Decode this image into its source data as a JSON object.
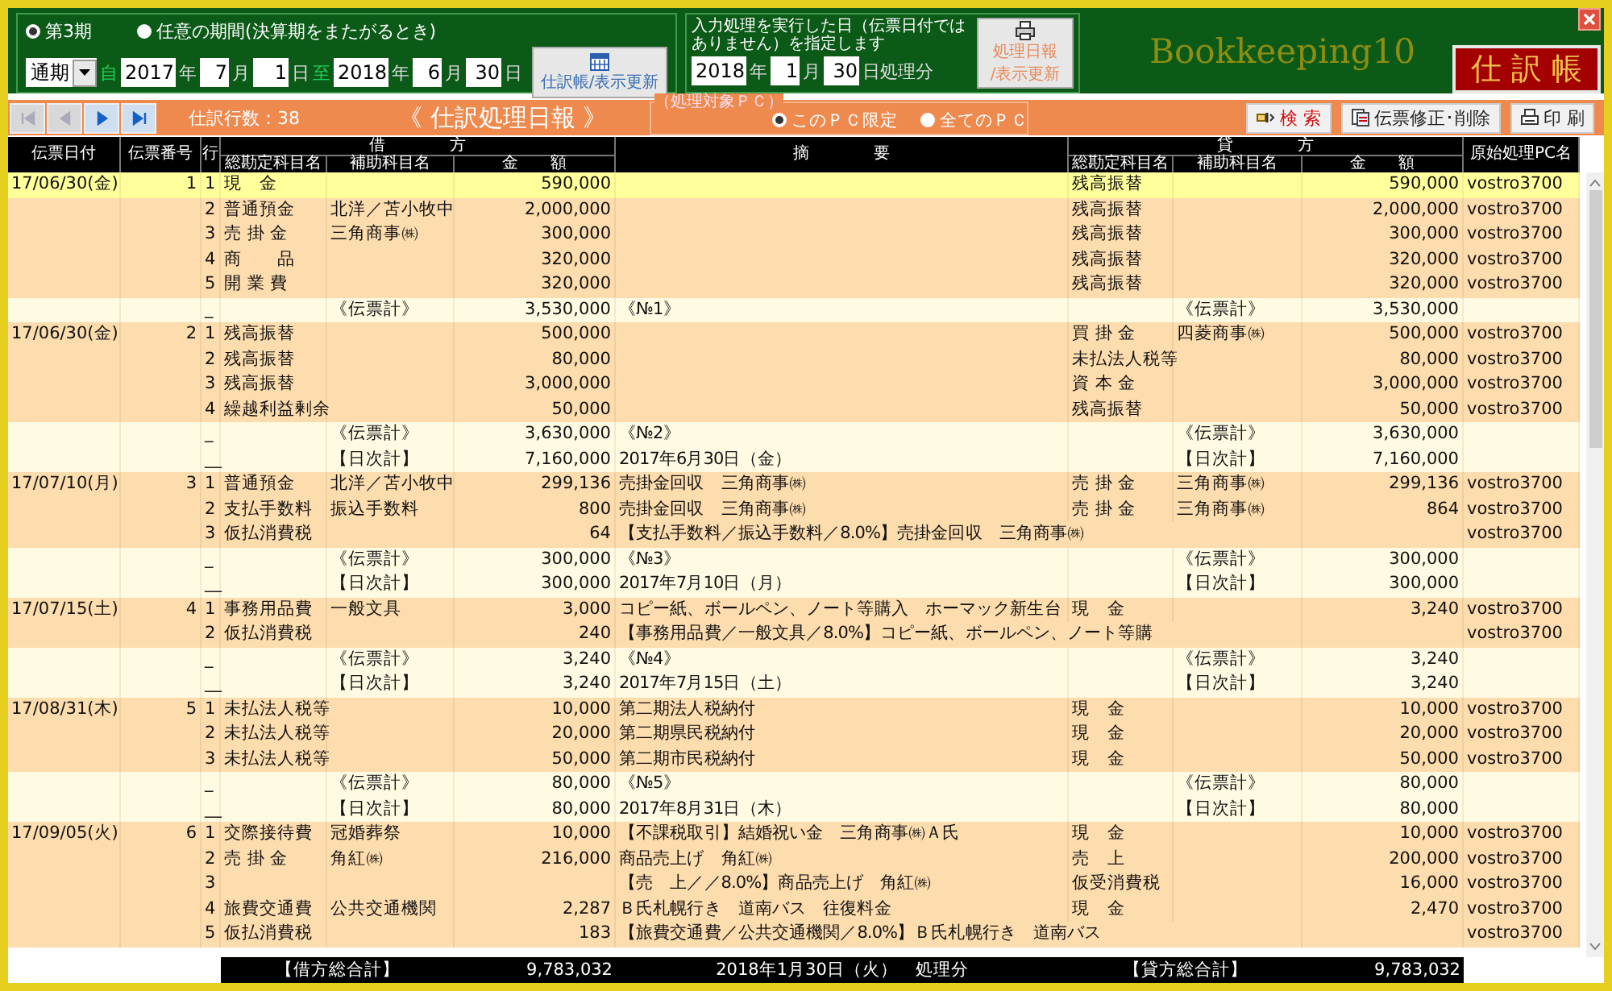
{
  "period": {
    "options": [
      {
        "label": "第3期",
        "selected": true
      },
      {
        "label": "任意の期間(決算期をまたがるとき)",
        "selected": false
      }
    ],
    "mode": "通期",
    "from_marker": "自",
    "from": [
      {
        "value": "2017",
        "unit": "年"
      },
      {
        "value": "7",
        "unit": "月"
      },
      {
        "value": "1",
        "unit": "日"
      }
    ],
    "to_marker": "至",
    "to": [
      {
        "value": "2018",
        "unit": "年"
      },
      {
        "value": "6",
        "unit": "月"
      },
      {
        "value": "30",
        "unit": "日"
      }
    ],
    "button": "仕訳帳/表示更新"
  },
  "process_date": {
    "note": "入力処理を実行した日（伝票日付ではありません）を指定します",
    "parts": [
      {
        "value": "2018",
        "unit": "年"
      },
      {
        "value": "1",
        "unit": "月"
      },
      {
        "value": "30",
        "unit": "日処理分"
      }
    ],
    "button_lines": [
      "処理日報",
      "/表示更新"
    ]
  },
  "app_name": "Bookkeeping10",
  "ledger_title": "仕 訳 帳",
  "toolbar": {
    "nav": [
      {
        "kind": "first",
        "disabled": true
      },
      {
        "kind": "prev",
        "disabled": true
      },
      {
        "kind": "next",
        "disabled": false
      },
      {
        "kind": "last",
        "disabled": false
      }
    ],
    "line_count": "仕訳行数：38",
    "report_title": "《 仕訳処理日報 》",
    "pc_filter": {
      "legend": "（処理対象ＰＣ）",
      "options": [
        {
          "label": "このＰＣ限定",
          "selected": true
        },
        {
          "label": "全てのＰＣ",
          "selected": false
        }
      ]
    },
    "buttons": [
      {
        "label": "検 索",
        "kind": "search"
      },
      {
        "label": "伝票修正･削除",
        "kind": "edit"
      },
      {
        "label": "印 刷",
        "kind": "print"
      }
    ]
  },
  "table": {
    "columns": {
      "date": "伝票日付",
      "no": "伝票番号",
      "line": "行",
      "debit": "借　　　　方",
      "memo": "摘　　　　要",
      "credit": "貸　　　　方",
      "pc": "原始処理PC名",
      "account": "総勘定科目名",
      "sub_account": "補助科目名",
      "amount": "金　　額",
      "account_cr": "総勘定科目名",
      "sub_account_cr": "補助科目名",
      "amount_cr": "金　　額"
    },
    "rows": [
      {
        "kind": "entry",
        "selected": true,
        "date": "17/06/30(金)",
        "no": "1",
        "line": "1",
        "dr_account": "現　金",
        "dr_amount": "590,000",
        "cr_account": "残高振替",
        "cr_amount": "590,000",
        "pc": "vostro3700"
      },
      {
        "kind": "entry",
        "selected": false,
        "line": "2",
        "dr_account": "普通預金",
        "dr_sub": "北洋／苫小牧中",
        "dr_amount": "2,000,000",
        "cr_account": "残高振替",
        "cr_amount": "2,000,000",
        "pc": "vostro3700"
      },
      {
        "kind": "entry",
        "selected": false,
        "line": "3",
        "dr_account": "売 掛 金",
        "dr_sub": "三角商事㈱",
        "dr_amount": "300,000",
        "cr_account": "残高振替",
        "cr_amount": "300,000",
        "pc": "vostro3700"
      },
      {
        "kind": "entry",
        "selected": false,
        "line": "4",
        "dr_account": "商　　品",
        "dr_amount": "320,000",
        "cr_account": "残高振替",
        "cr_amount": "320,000",
        "pc": "vostro3700"
      },
      {
        "kind": "entry",
        "selected": false,
        "line": "5",
        "dr_account": "開 業 費",
        "dr_amount": "320,000",
        "cr_account": "残高振替",
        "cr_amount": "320,000",
        "pc": "vostro3700"
      },
      {
        "kind": "total",
        "selected": false,
        "line": "_",
        "dr_sub": "《伝票計》",
        "dr_amount": "3,530,000",
        "memo": "《№1》",
        "cr_sub": "《伝票計》",
        "cr_amount": "3,530,000"
      },
      {
        "kind": "entry",
        "selected": false,
        "date": "17/06/30(金)",
        "no": "2",
        "line": "1",
        "dr_account": "残高振替",
        "dr_amount": "500,000",
        "cr_account": "買 掛 金",
        "cr_sub": "四菱商事㈱",
        "cr_amount": "500,000",
        "pc": "vostro3700"
      },
      {
        "kind": "entry",
        "selected": false,
        "line": "2",
        "dr_account": "残高振替",
        "dr_amount": "80,000",
        "cr_account": "未払法人税等",
        "cr_amount": "80,000",
        "pc": "vostro3700"
      },
      {
        "kind": "entry",
        "selected": false,
        "line": "3",
        "dr_account": "残高振替",
        "dr_amount": "3,000,000",
        "cr_account": "資 本 金",
        "cr_amount": "3,000,000",
        "pc": "vostro3700"
      },
      {
        "kind": "entry",
        "selected": false,
        "line": "4",
        "dr_account": "繰越利益剰余",
        "dr_amount": "50,000",
        "cr_account": "残高振替",
        "cr_amount": "50,000",
        "pc": "vostro3700"
      },
      {
        "kind": "total",
        "selected": false,
        "line": "_",
        "dr_sub": "《伝票計》",
        "dr_amount": "3,630,000",
        "memo": "《№2》",
        "cr_sub": "《伝票計》",
        "cr_amount": "3,630,000"
      },
      {
        "kind": "total",
        "selected": false,
        "line": "__",
        "dr_sub": "【日次計】",
        "dr_amount": "7,160,000",
        "memo": "2017年6月30日（金）",
        "cr_sub": "【日次計】",
        "cr_amount": "7,160,000"
      },
      {
        "kind": "entry",
        "selected": false,
        "date": "17/07/10(月)",
        "no": "3",
        "line": "1",
        "dr_account": "普通預金",
        "dr_sub": "北洋／苫小牧中",
        "dr_amount": "299,136",
        "memo": "売掛金回収　三角商事㈱",
        "cr_account": "売 掛 金",
        "cr_sub": "三角商事㈱",
        "cr_amount": "299,136",
        "pc": "vostro3700"
      },
      {
        "kind": "entry",
        "selected": false,
        "line": "2",
        "dr_account": "支払手数料",
        "dr_sub": "振込手数料",
        "dr_amount": "800",
        "memo": "売掛金回収　三角商事㈱",
        "cr_account": "売 掛 金",
        "cr_sub": "三角商事㈱",
        "cr_amount": "864",
        "pc": "vostro3700"
      },
      {
        "kind": "entry",
        "selected": false,
        "line": "3",
        "dr_account": "仮払消費税",
        "dr_amount": "64",
        "memo": "【支払手数料／振込手数料／8.0%】売掛金回収　三角商事㈱",
        "pc": "vostro3700"
      },
      {
        "kind": "total",
        "selected": false,
        "line": "_",
        "dr_sub": "《伝票計》",
        "dr_amount": "300,000",
        "memo": "《№3》",
        "cr_sub": "《伝票計》",
        "cr_amount": "300,000"
      },
      {
        "kind": "total",
        "selected": false,
        "line": "__",
        "dr_sub": "【日次計】",
        "dr_amount": "300,000",
        "memo": "2017年7月10日（月）",
        "cr_sub": "【日次計】",
        "cr_amount": "300,000"
      },
      {
        "kind": "entry",
        "selected": false,
        "date": "17/07/15(土)",
        "no": "4",
        "line": "1",
        "dr_account": "事務用品費",
        "dr_sub": "一般文具",
        "dr_amount": "3,000",
        "memo": "コピー紙、ボールペン、ノート等購入　ホーマック新生台",
        "cr_account": "現　金",
        "cr_amount": "3,240",
        "pc": "vostro3700"
      },
      {
        "kind": "entry",
        "selected": false,
        "line": "2",
        "dr_account": "仮払消費税",
        "dr_amount": "240",
        "memo": "【事務用品費／一般文具／8.0%】コピー紙、ボールペン、ノート等購",
        "pc": "vostro3700"
      },
      {
        "kind": "total",
        "selected": false,
        "line": "_",
        "dr_sub": "《伝票計》",
        "dr_amount": "3,240",
        "memo": "《№4》",
        "cr_sub": "《伝票計》",
        "cr_amount": "3,240"
      },
      {
        "kind": "total",
        "selected": false,
        "line": "__",
        "dr_sub": "【日次計】",
        "dr_amount": "3,240",
        "memo": "2017年7月15日（土）",
        "cr_sub": "【日次計】",
        "cr_amount": "3,240"
      },
      {
        "kind": "entry",
        "selected": false,
        "date": "17/08/31(木)",
        "no": "5",
        "line": "1",
        "dr_account": "未払法人税等",
        "dr_amount": "10,000",
        "memo": "第二期法人税納付",
        "cr_account": "現　金",
        "cr_amount": "10,000",
        "pc": "vostro3700"
      },
      {
        "kind": "entry",
        "selected": false,
        "line": "2",
        "dr_account": "未払法人税等",
        "dr_amount": "20,000",
        "memo": "第二期県民税納付",
        "cr_account": "現　金",
        "cr_amount": "20,000",
        "pc": "vostro3700"
      },
      {
        "kind": "entry",
        "selected": false,
        "line": "3",
        "dr_account": "未払法人税等",
        "dr_amount": "50,000",
        "memo": "第二期市民税納付",
        "cr_account": "現　金",
        "cr_amount": "50,000",
        "pc": "vostro3700"
      },
      {
        "kind": "total",
        "selected": false,
        "line": "_",
        "dr_sub": "《伝票計》",
        "dr_amount": "80,000",
        "memo": "《№5》",
        "cr_sub": "《伝票計》",
        "cr_amount": "80,000"
      },
      {
        "kind": "total",
        "selected": false,
        "line": "__",
        "dr_sub": "【日次計】",
        "dr_amount": "80,000",
        "memo": "2017年8月31日（木）",
        "cr_sub": "【日次計】",
        "cr_amount": "80,000"
      },
      {
        "kind": "entry",
        "selected": false,
        "date": "17/09/05(火)",
        "no": "6",
        "line": "1",
        "dr_account": "交際接待費",
        "dr_sub": "冠婚葬祭",
        "dr_amount": "10,000",
        "memo": "【不課税取引】結婚祝い金　三角商事㈱Ａ氏",
        "cr_account": "現　金",
        "cr_amount": "10,000",
        "pc": "vostro3700"
      },
      {
        "kind": "entry",
        "selected": false,
        "line": "2",
        "dr_account": "売 掛 金",
        "dr_sub": "角紅㈱",
        "dr_amount": "216,000",
        "memo": "商品売上げ　角紅㈱",
        "cr_account": "売　上",
        "cr_amount": "200,000",
        "pc": "vostro3700"
      },
      {
        "kind": "entry",
        "selected": false,
        "line": "3",
        "memo": "【売　上／／8.0%】商品売上げ　角紅㈱",
        "cr_account": "仮受消費税",
        "cr_amount": "16,000",
        "pc": "vostro3700"
      },
      {
        "kind": "entry",
        "selected": false,
        "line": "4",
        "dr_account": "旅費交通費",
        "dr_sub": "公共交通機関",
        "dr_amount": "2,287",
        "memo": "Ｂ氏札幌行き　道南バス　往復料金",
        "cr_account": "現　金",
        "cr_amount": "2,470",
        "pc": "vostro3700"
      },
      {
        "kind": "entry",
        "selected": false,
        "line": "5",
        "dr_account": "仮払消費税",
        "dr_amount": "183",
        "memo": "【旅費交通費／公共交通機関／8.0%】Ｂ氏札幌行き　道南バス",
        "pc": "vostro3700"
      }
    ]
  },
  "totals": {
    "debit_label": "【借方総合計】",
    "debit_total": "9,783,032",
    "process_note": "2018年1月30日（火）　処理分",
    "credit_label": "【貸方総合計】",
    "credit_total": "9,783,032"
  }
}
